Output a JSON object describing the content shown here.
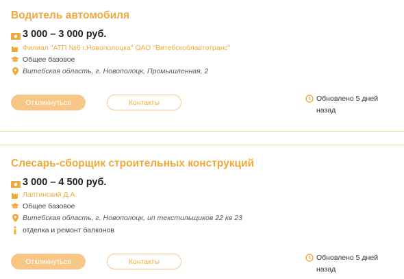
{
  "colors": {
    "accent": "#f2a93b",
    "button_fill": "#f8c787",
    "divider": "#f0d6ad"
  },
  "vacancies": [
    {
      "title": "Водитель автомобиля",
      "salary": "3 000 – 3 000 руб.",
      "employer": "Филиал \"АТП №6 г.Новополоцка\" ОАО \"Витебскоблавтотранс\"",
      "education": "Общее базовое",
      "address": "Витебская область, г. Новополоцк, Промышленная, 2",
      "respond_label": "Откликнуться",
      "contacts_label": "Контакты",
      "updated": "Обновлено 5 дней назад"
    },
    {
      "title": "Слесарь-сборщик строительных конструкций",
      "salary": "3 000 – 4 500 руб.",
      "employer": "Лаптинский Д.А.",
      "education": "Общее базовое",
      "address": "Витебская область, г. Новополоцк, ип текстильщиков 22 кв 23",
      "description": "отделка и ремонт балконов",
      "respond_label": "Откликнуться",
      "contacts_label": "Контакты",
      "updated": "Обновлено 5 дней назад"
    }
  ],
  "icons": [
    "money-icon",
    "building-icon",
    "graduation-cap-icon",
    "location-pin-icon",
    "info-icon",
    "clock-icon"
  ]
}
